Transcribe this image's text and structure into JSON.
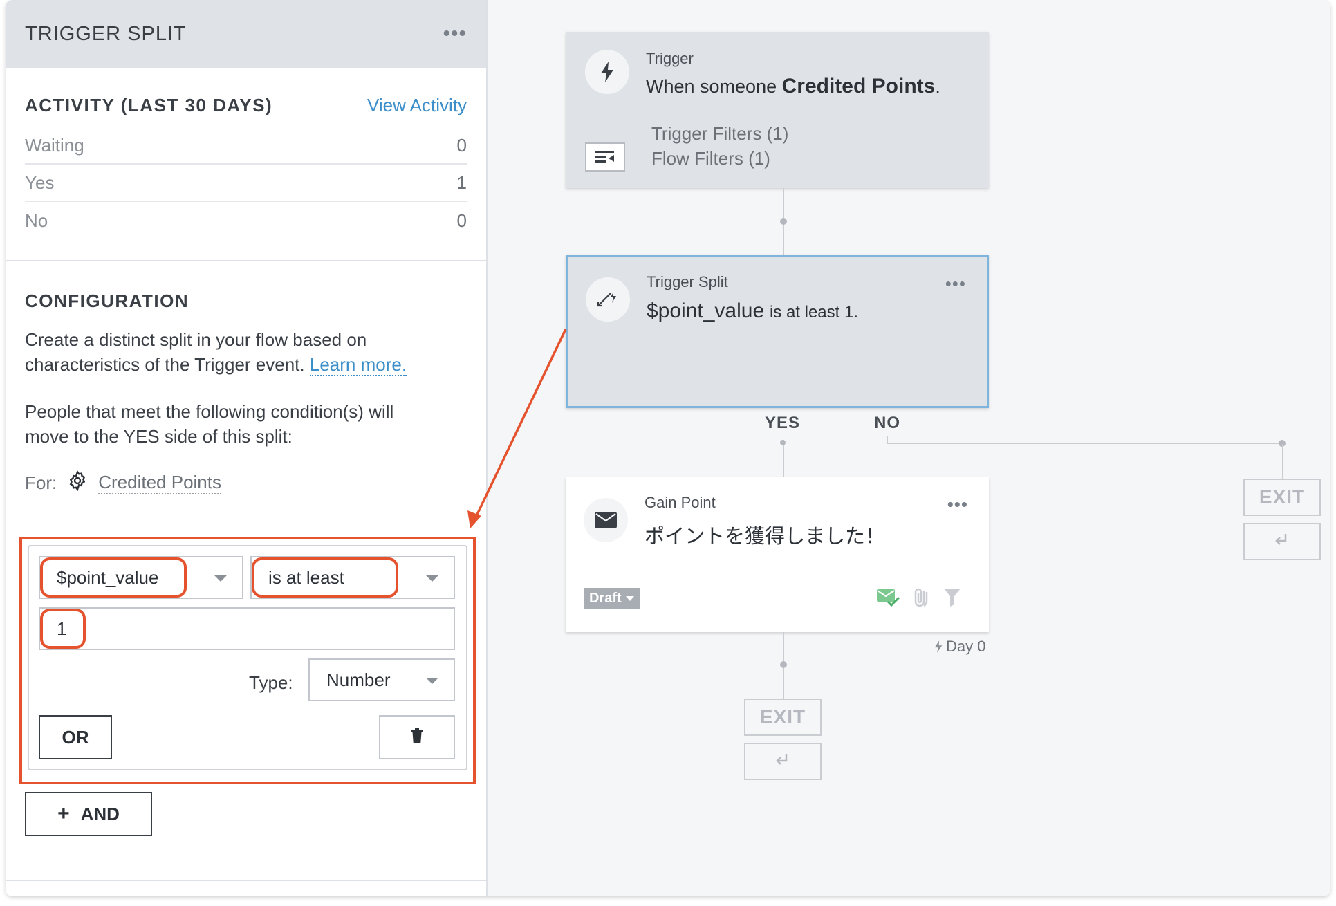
{
  "sidebar": {
    "title": "TRIGGER SPLIT",
    "activity": {
      "title": "ACTIVITY (LAST 30 DAYS)",
      "link": "View Activity",
      "rows": [
        {
          "label": "Waiting",
          "value": "0"
        },
        {
          "label": "Yes",
          "value": "1"
        },
        {
          "label": "No",
          "value": "0"
        }
      ]
    },
    "configuration": {
      "title": "CONFIGURATION",
      "desc": "Create a distinct split in your flow based on characteristics of the Trigger event.",
      "learn_more": "Learn more.",
      "people_text": "People that meet the following condition(s) will move to the YES side of this split:",
      "for_label": "For:",
      "for_value": "Credited Points"
    },
    "condition": {
      "property": "$point_value",
      "operator": "is at least",
      "value": "1",
      "type_label": "Type:",
      "type_value": "Number",
      "or_label": "OR",
      "and_label": "AND"
    }
  },
  "canvas": {
    "trigger": {
      "label": "Trigger",
      "text_prefix": "When someone",
      "text_bold": "Credited Points",
      "text_suffix": ".",
      "filter1": "Trigger Filters (1)",
      "filter2": "Flow Filters (1)"
    },
    "split": {
      "label": "Trigger Split",
      "property": "$point_value",
      "condition": "is at least 1."
    },
    "branches": {
      "yes": "YES",
      "no": "NO"
    },
    "email": {
      "label": "Gain Point",
      "text": "ポイントを獲得しました！",
      "status": "Draft",
      "delay": "Day 0"
    },
    "exit_label": "EXIT"
  },
  "colors": {
    "accent_orange": "#e4532e",
    "link_blue": "#3d8fc9",
    "selected_border": "#7fb5dc"
  }
}
